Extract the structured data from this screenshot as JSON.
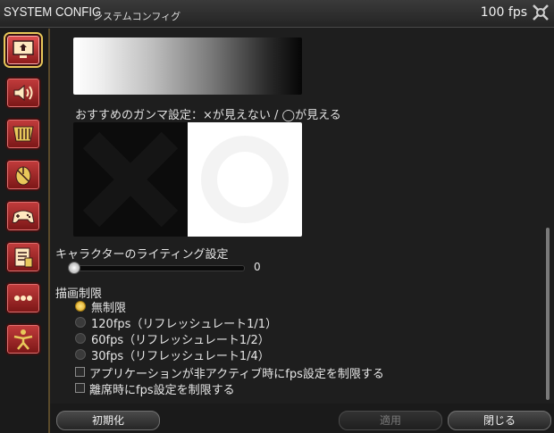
{
  "window": {
    "title": "SYSTEM CONFIG",
    "subtitle": "システムコンフィグ",
    "fps": "100 fps"
  },
  "sidebar": {
    "items": [
      {
        "name": "display",
        "icon": "monitor-icon",
        "active": true
      },
      {
        "name": "sound",
        "icon": "speaker-icon",
        "active": false
      },
      {
        "name": "graphics",
        "icon": "filter-icon",
        "active": false
      },
      {
        "name": "mouse",
        "icon": "mouse-icon",
        "active": false
      },
      {
        "name": "gamepad",
        "icon": "gamepad-icon",
        "active": false
      },
      {
        "name": "other",
        "icon": "document-icon",
        "active": false
      },
      {
        "name": "more",
        "icon": "dots-icon",
        "active": false
      },
      {
        "name": "character",
        "icon": "figure-icon",
        "active": false
      }
    ]
  },
  "gamma": {
    "label": "おすすめのガンマ設定：×が見えない / ◯が見える"
  },
  "lighting": {
    "label": "キャラクターのライティング設定",
    "value": "0",
    "slider_fraction": 0
  },
  "framerate": {
    "label": "描画制限",
    "options": [
      {
        "label": "無制限",
        "selected": true
      },
      {
        "label": "120fps（リフレッシュレート1/1）",
        "selected": false
      },
      {
        "label": "60fps（リフレッシュレート1/2）",
        "selected": false
      },
      {
        "label": "30fps（リフレッシュレート1/4）",
        "selected": false
      }
    ],
    "checkboxes": [
      {
        "label": "アプリケーションが非アクティブ時にfps設定を制限する",
        "checked": false
      },
      {
        "label": "離席時にfps設定を制限する",
        "checked": false
      }
    ]
  },
  "buttons": {
    "reset": "初期化",
    "apply": "適用",
    "close": "閉じる"
  },
  "colors": {
    "accent_gold": "#e8c85a",
    "sidebar_red": "#c23c3c",
    "background": "#1e1e1e"
  }
}
